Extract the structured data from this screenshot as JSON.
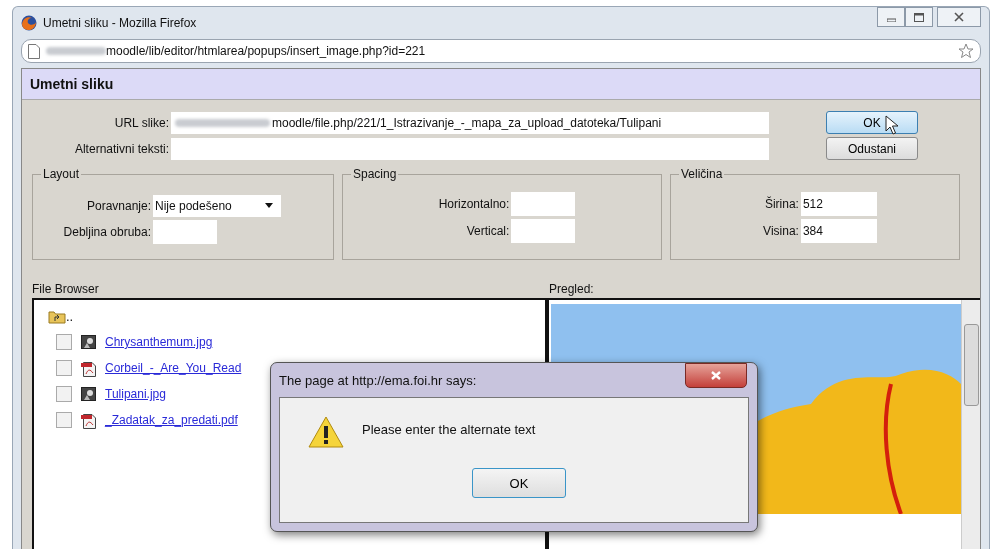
{
  "window": {
    "title": "Umetni sliku - Mozilla Firefox"
  },
  "address_bar": {
    "url": "moodle/lib/editor/htmlarea/popups/insert_image.php?id=221",
    "blurred_prefix": true
  },
  "dialog": {
    "heading": "Umetni sliku"
  },
  "fields": [
    {
      "label": "URL slike:",
      "value": "moodle/file.php/221/1_Istrazivanje_-_mapa_za_upload_datoteka/Tulipani",
      "blurred_prefix": true
    },
    {
      "label": "Alternativni teksti:",
      "blurred_prefix": false
    }
  ],
  "buttons": [
    {
      "label": "OK",
      "hovered": true
    },
    {
      "label": "Odustani",
      "hovered": false
    }
  ],
  "fieldsets": [
    {
      "legend": "Layout",
      "rows": [
        {
          "label": "Poravnanje:",
          "kind": "select",
          "value": "Nije podešeno"
        },
        {
          "label": "Debljina obruba:",
          "kind": "input"
        }
      ]
    },
    {
      "legend": "Spacing",
      "rows": [
        {
          "label": "Horizontalno:",
          "kind": "input"
        },
        {
          "label": "Vertical:",
          "kind": "input"
        }
      ]
    },
    {
      "legend": "Veličina",
      "rows": [
        {
          "label": "Širina:",
          "kind": "input",
          "value": "512"
        },
        {
          "label": "Visina:",
          "kind": "input",
          "value": "384"
        }
      ]
    }
  ],
  "file_browser": {
    "label": "File Browser",
    "parent": "..",
    "files": [
      {
        "name": "Chrysanthemum.jpg",
        "kind": "image",
        "checked": false
      },
      {
        "name": "Corbeil_-_Are_You_Read",
        "kind": "pdf",
        "checked": false
      },
      {
        "name": "Tulipani.jpg",
        "kind": "image",
        "checked": false
      },
      {
        "name": "_Zadatak_za_predati.pdf",
        "kind": "pdf",
        "checked": false
      }
    ]
  },
  "preview": {
    "label": "Pregled:"
  },
  "alert": {
    "title": "The page at http://ema.foi.hr says:",
    "message": "Please enter the alternate text",
    "button": "OK"
  }
}
